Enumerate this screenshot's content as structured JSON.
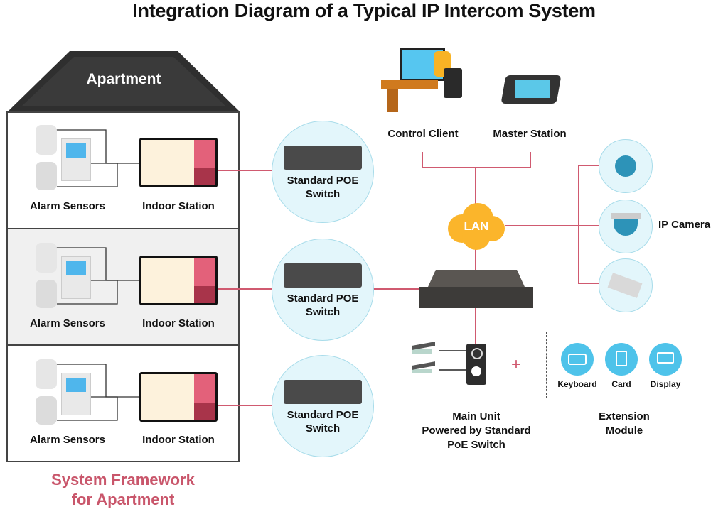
{
  "title": "Integration Diagram of a Typical IP Intercom System",
  "apartment": {
    "roof_label": "Apartment",
    "floors": [
      {
        "sensor_label": "Alarm Sensors",
        "station_label": "Indoor Station",
        "switch_label_line1": "Standard POE",
        "switch_label_line2": "Switch"
      },
      {
        "sensor_label": "Alarm Sensors",
        "station_label": "Indoor Station",
        "switch_label_line1": "Standard POE",
        "switch_label_line2": "Switch"
      },
      {
        "sensor_label": "Alarm Sensors",
        "station_label": "Indoor Station",
        "switch_label_line1": "Standard POE",
        "switch_label_line2": "Switch"
      }
    ],
    "caption_line1": "System Framework",
    "caption_line2": "for Apartment"
  },
  "network": {
    "control_client_label": "Control Client",
    "master_station_label": "Master Station",
    "lan_label": "LAN",
    "ip_camera_label": "IP Camera",
    "main_unit_line1": "Main Unit",
    "main_unit_line2": "Powered by Standard",
    "main_unit_line3": "PoE Switch",
    "plus_symbol": "+"
  },
  "extension": {
    "items": [
      {
        "label": "Keyboard",
        "icon": "keyboard-icon"
      },
      {
        "label": "Card",
        "icon": "card-icon"
      },
      {
        "label": "Display",
        "icon": "display-icon"
      }
    ],
    "caption_line1": "Extension",
    "caption_line2": "Module"
  },
  "colors": {
    "link_line": "#d05a70",
    "accent_pink": "#c9566b",
    "lan_cloud": "#fbb52b",
    "circle_fill": "#e3f6fb",
    "ext_blue": "#4ec3ea",
    "roof": "#2f2f2f"
  }
}
